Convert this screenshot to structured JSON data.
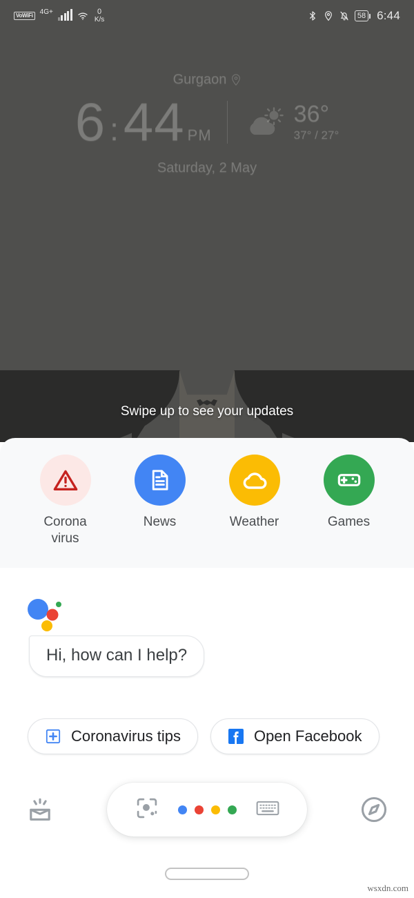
{
  "status_bar": {
    "vowifi_label": "VoWiFi",
    "network_type": "4G",
    "network_sup": "+",
    "data_speed_value": "0",
    "data_speed_unit": "K/s",
    "bluetooth_icon": "bluetooth-icon",
    "location_icon": "location-pin-icon",
    "silent_icon": "bell-off-icon",
    "battery_level": "58",
    "time": "6:44"
  },
  "clock_widget": {
    "city": "Gurgaon",
    "location_icon": "location-pin-icon",
    "hour": "6",
    "minute": "44",
    "meridiem": "PM",
    "weather_icon": "partly-cloudy-icon",
    "temp_current": "36°",
    "temp_high_low": "37° / 27°",
    "date": "Saturday, 2 May"
  },
  "swipe_hint": "Swipe up to see your updates",
  "shortcuts": {
    "items": [
      {
        "label": "Corona virus",
        "icon": "warning-triangle-icon",
        "bg": "#fce8e6",
        "fg": "#c5221f"
      },
      {
        "label": "News",
        "icon": "document-icon",
        "bg": "#4285f4",
        "fg": "#ffffff"
      },
      {
        "label": "Weather",
        "icon": "cloud-icon",
        "bg": "#fbbc04",
        "fg": "#ffffff"
      },
      {
        "label": "Games",
        "icon": "gamepad-icon",
        "bg": "#34a853",
        "fg": "#ffffff"
      }
    ]
  },
  "assistant": {
    "logo_icon": "google-assistant-logo",
    "greeting": "Hi, how can I help?",
    "suggestions": [
      {
        "label": "Coronavirus tips",
        "icon": "medical-plus-icon"
      },
      {
        "label": "Open Facebook",
        "icon": "facebook-icon"
      }
    ]
  },
  "bottom_bar": {
    "left_icon": "snapshot-updates-icon",
    "lens_icon": "google-lens-icon",
    "mic_icon": "google-mic-dots",
    "keyboard_icon": "keyboard-icon",
    "right_icon": "explore-compass-icon"
  },
  "navigation": {
    "gesture_pill": "home-gesture-pill"
  },
  "watermark": "wsxdn.com",
  "colors": {
    "google_blue": "#4285f4",
    "google_red": "#ea4335",
    "google_yellow": "#fbbc04",
    "google_green": "#34a853",
    "facebook_blue": "#1877f2",
    "wallpaper_gray": "#6a6a68",
    "panel_gray": "#f8f9fa"
  }
}
